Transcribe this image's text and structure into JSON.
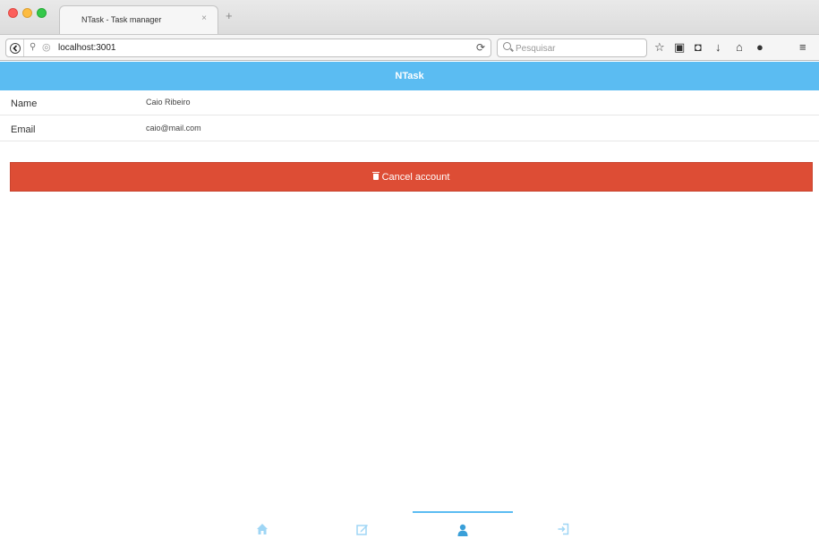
{
  "browser": {
    "tab_title": "NTask - Task manager",
    "tab_close": "×",
    "new_tab": "+",
    "url": "localhost:3001",
    "search_placeholder": "Pesquisar"
  },
  "app": {
    "title": "NTask",
    "profile": {
      "rows": [
        {
          "label": "Name",
          "value": "Caio Ribeiro"
        },
        {
          "label": "Email",
          "value": "caio@mail.com"
        }
      ]
    },
    "cancel_button_label": "Cancel account"
  },
  "bottom_nav": {
    "active_tab": "profile",
    "items": [
      "home-icon",
      "edit-icon",
      "user-icon",
      "sign-in-icon"
    ]
  },
  "colors": {
    "header": "#5bbcf2",
    "cancel_button": "#dd4d35",
    "nav_icon": "#9fd6f5",
    "nav_icon_active": "#3a9fd8"
  }
}
